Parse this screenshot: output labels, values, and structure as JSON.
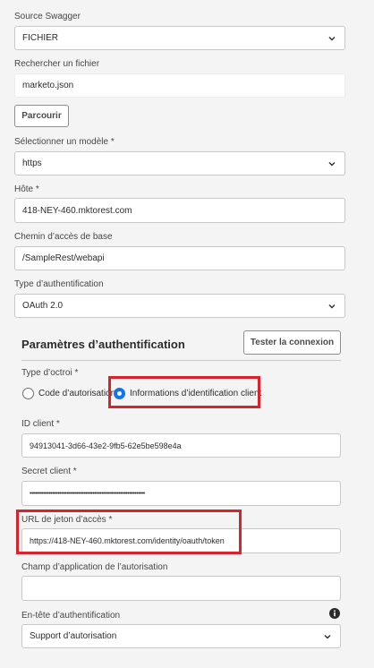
{
  "source": {
    "label": "Source Swagger",
    "value": "FICHIER"
  },
  "file_search": {
    "label": "Rechercher un fichier",
    "value": "marketo.json",
    "browse_label": "Parcourir"
  },
  "template": {
    "label": "Sélectionner un modèle *",
    "value": "https"
  },
  "host": {
    "label": "Hôte *",
    "value": "418-NEY-460.mktorest.com"
  },
  "base_path": {
    "label": "Chemin d’accès de base",
    "value": "/SampleRest/webapi"
  },
  "auth_type": {
    "label": "Type d’authentification",
    "value": "OAuth 2.0"
  },
  "auth_params": {
    "title": "Paramètres d’authentification",
    "test_button": "Tester la connexion",
    "grant_type_label": "Type d’octroi *",
    "grant_options": [
      {
        "label": "Code d’autorisation",
        "checked": false
      },
      {
        "label": "Informations d’identification client",
        "checked": true
      }
    ],
    "client_id_label": "ID client *",
    "client_id_value": "94913041-3d66-43e2-9fb5-62e5be598e4a",
    "client_secret_label": "Secret client *",
    "client_secret_value": "••••••••••••••••••••••••••••••••••••••••••••••••••••••••••••••••••",
    "token_url_label": "URL de jeton d’accès *",
    "token_url_value": "https://418-NEY-460.mktorest.com/identity/oauth/token",
    "scope_label": "Champ d’application de l’autorisation",
    "scope_value": "",
    "auth_header_label": "En-tête d’authentification",
    "auth_header_value": "Support d’autorisation"
  },
  "colors": {
    "accent": "#1473e6",
    "highlight": "#d7232b"
  }
}
